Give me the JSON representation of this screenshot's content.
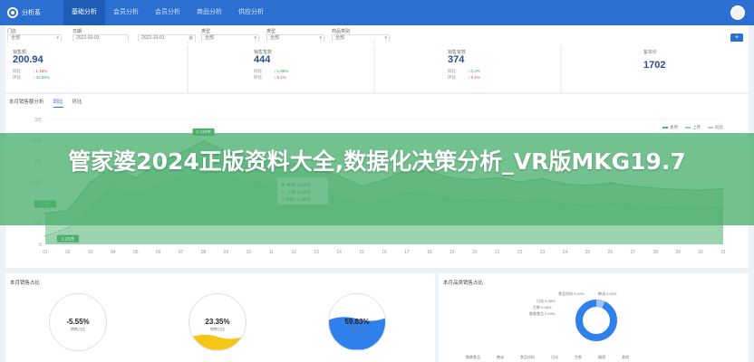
{
  "nav": {
    "brand": "分析系",
    "items": [
      "基础分析",
      "会员分析",
      "会员分析",
      "商品分析",
      "供应分析"
    ]
  },
  "filters": {
    "labels": [
      "门店",
      "日期",
      "",
      "类型",
      "类型",
      "商品类别"
    ],
    "values": [
      "全部",
      "2022-02-03",
      "2022-10-01",
      "全部",
      "全部",
      "全部"
    ]
  },
  "kpis": [
    {
      "title": "销售额",
      "value": "200.94",
      "r1l": "同比",
      "r1v": "↑ 1.15%",
      "r2l": "环比",
      "r2v": "↑ 43.69%"
    },
    {
      "title": "销售笔数",
      "value": "444",
      "r1l": "同比",
      "r1v": "↓ 1.95%",
      "r2l": "环比",
      "r2v": "↑ 5.1%"
    },
    {
      "title": "销售客数",
      "value": "374",
      "r1l": "同比",
      "r1v": "↓ 0.2%",
      "r2l": "环比",
      "r2v": "↑ 5.1%"
    },
    {
      "title": "客单价",
      "value": "1702",
      "r1l": "",
      "r1v": "",
      "r2l": "",
      "r2v": ""
    }
  ],
  "chart": {
    "tabs": [
      "本月销售额分析",
      "同比",
      "环比"
    ],
    "legend": [
      "本月",
      "上月",
      "同比"
    ],
    "callouts": [
      "2.233万",
      "1.7万",
      "2.23万"
    ],
    "tooltip": [
      "本月: 1.23万",
      "上月: 1.18万",
      "同比: 1.45万"
    ]
  },
  "chart_data": {
    "type": "line",
    "x": [
      "01",
      "02",
      "03",
      "04",
      "05",
      "06",
      "07",
      "08",
      "09",
      "10",
      "11",
      "12",
      "13",
      "14",
      "15",
      "16",
      "17",
      "18",
      "19",
      "20",
      "21",
      "22",
      "23",
      "24",
      "25",
      "26",
      "27",
      "28",
      "29",
      "30",
      "31"
    ],
    "yticks": [
      "3万",
      "2.5万",
      "2万",
      "1.5万",
      "1万",
      "5千",
      "0"
    ],
    "ylim": [
      0,
      30000
    ],
    "series": [
      {
        "name": "本月",
        "values": [
          7500,
          8200,
          15000,
          18600,
          16000,
          19500,
          22000,
          24800,
          22500,
          21000,
          20800,
          19500,
          18000,
          16500,
          14000,
          15500,
          18000,
          17500,
          16000,
          15500,
          16000,
          15000,
          15800,
          14500,
          14200,
          14800,
          14000,
          13500,
          13200,
          13000,
          13400
        ]
      },
      {
        "name": "上月",
        "values": [
          2000,
          4000,
          9000,
          14000,
          12000,
          14500,
          16000,
          18000,
          16500,
          15000,
          14500,
          13500,
          12500,
          11500,
          9500,
          10500,
          12500,
          12000,
          11000,
          10500,
          11000,
          10000,
          10800,
          9800,
          9500,
          10000,
          9500,
          9000,
          8800,
          8700,
          9000
        ]
      }
    ],
    "grid": true,
    "legend_position": "top-right"
  },
  "rings": {
    "title": "本月销售占比",
    "items": [
      {
        "pct": "-5.55%",
        "label": "销售占比"
      },
      {
        "pct": "23.35%",
        "label": "销售占比"
      },
      {
        "pct": "59.83%",
        "label": "销售占比"
      }
    ]
  },
  "donut": {
    "title": "本月品类销售占比",
    "labels": [
      "食品饮料 0.00%",
      "粮油 0.00%",
      "日化 0.38%",
      "生鲜 0.08%",
      "散装食品 0.19%"
    ],
    "legend": [
      "散装食品",
      "粮油",
      "食品饮料",
      "日化",
      "生鲜",
      "烟酒",
      "其他"
    ]
  },
  "banner": {
    "text": "管家婆2024正版资料大全,数据化决策分析_VR版MKG19.7"
  },
  "colors": {
    "primary": "#2b6fd1",
    "green": "#4caf6e",
    "yellow": "#f5c518",
    "blue": "#2f80ed"
  }
}
